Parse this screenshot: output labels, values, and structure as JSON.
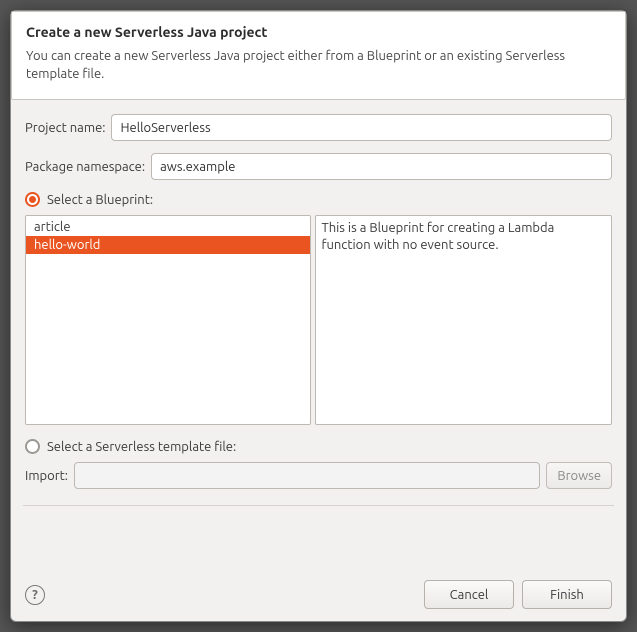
{
  "header": {
    "title": "Create a new Serverless Java project",
    "subtitle": "You can create a new Serverless Java project either from a Blueprint\nor an existing Serverless template file."
  },
  "project_name": {
    "label": "Project name:",
    "value": "HelloServerless"
  },
  "package_namespace": {
    "label": "Package namespace:",
    "value": "aws.example"
  },
  "blueprint_radio": {
    "label": "Select a Blueprint:"
  },
  "blueprints": {
    "items": [
      "article",
      "hello-world"
    ],
    "selected_index": 1,
    "description": "This is a Blueprint for creating a Lambda function with no event source."
  },
  "template_radio": {
    "label": "Select a Serverless template file:"
  },
  "import": {
    "label": "Import:",
    "value": "",
    "browse": "Browse"
  },
  "buttons": {
    "cancel": "Cancel",
    "finish": "Finish"
  }
}
